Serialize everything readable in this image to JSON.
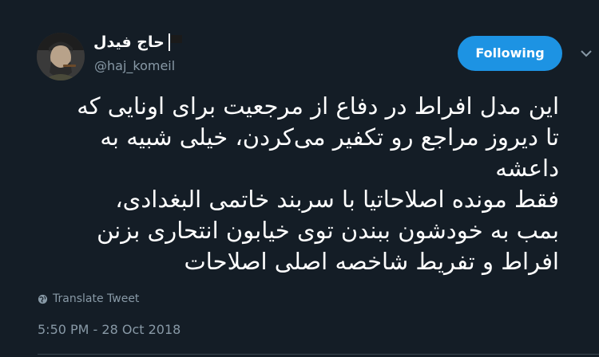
{
  "author": {
    "display_name": "حاج فیدل",
    "username": "@haj_komeil",
    "avatar_icon": "portrait-avatar"
  },
  "follow_button": {
    "label": "Following",
    "color": "#1d93e3"
  },
  "tweet": {
    "lines": [
      "این مدل افراط در دفاع از مرجعیت برای اونایی که",
      "تا دیروز مراجع رو تکفیر می‌کردن، خیلی شبیه به",
      "داعشه",
      "فقط مونده اصلاحاتیا با سربند خاتمی البغدادی،",
      "بمب به خودشون ببندن توی خیابون انتحاری بزنن",
      "افراط و تفریط شاخصه اصلی اصلاحات"
    ],
    "translate_label": "Translate Tweet",
    "timestamp": "5:50 PM - 28 Oct 2018"
  },
  "colors": {
    "background": "#141d26",
    "secondary_text": "#8899a6",
    "divider": "#38444d"
  }
}
